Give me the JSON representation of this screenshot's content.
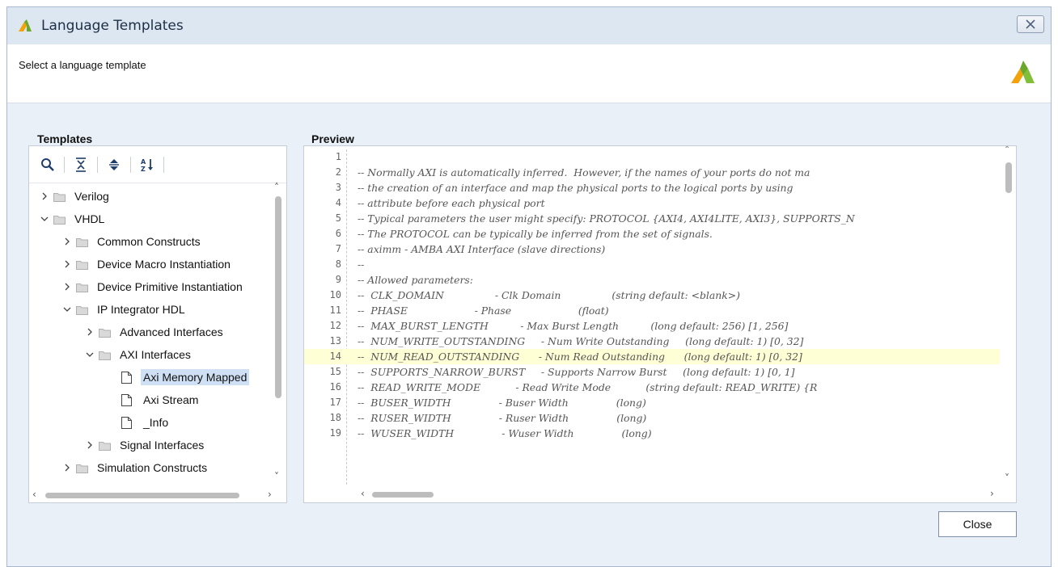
{
  "window": {
    "title": "Language Templates",
    "close_icon": "close-window-icon"
  },
  "header": {
    "instruction": "Select a language template",
    "logo": "xilinx-vivado-logo"
  },
  "templates": {
    "label": "Templates",
    "toolbar": [
      {
        "name": "search-icon",
        "tooltip": ""
      },
      {
        "name": "collapse-all-icon",
        "tooltip": ""
      },
      {
        "name": "expand-all-icon",
        "tooltip": ""
      },
      {
        "name": "sort-alpha-icon",
        "tooltip": ""
      }
    ],
    "tree": [
      {
        "label": "Verilog",
        "depth": 0,
        "kind": "folder",
        "expanded": false
      },
      {
        "label": "VHDL",
        "depth": 0,
        "kind": "folder",
        "expanded": true
      },
      {
        "label": "Common Constructs",
        "depth": 1,
        "kind": "folder",
        "expanded": false
      },
      {
        "label": "Device Macro Instantiation",
        "depth": 1,
        "kind": "folder",
        "expanded": false
      },
      {
        "label": "Device Primitive Instantiation",
        "depth": 1,
        "kind": "folder",
        "expanded": false
      },
      {
        "label": "IP Integrator HDL",
        "depth": 1,
        "kind": "folder",
        "expanded": true
      },
      {
        "label": "Advanced Interfaces",
        "depth": 2,
        "kind": "folder",
        "expanded": false
      },
      {
        "label": "AXI Interfaces",
        "depth": 2,
        "kind": "folder",
        "expanded": true
      },
      {
        "label": "Axi Memory Mapped",
        "depth": 3,
        "kind": "file",
        "selected": true
      },
      {
        "label": "Axi Stream",
        "depth": 3,
        "kind": "file"
      },
      {
        "label": "_Info",
        "depth": 3,
        "kind": "file"
      },
      {
        "label": "Signal Interfaces",
        "depth": 2,
        "kind": "folder",
        "expanded": false
      },
      {
        "label": "Simulation Constructs",
        "depth": 1,
        "kind": "folder",
        "expanded": false
      }
    ]
  },
  "preview": {
    "label": "Preview",
    "highlight_line": 14,
    "lines": [
      {
        "n": "1",
        "text": ""
      },
      {
        "n": "2",
        "text": "-- Normally AXI is automatically inferred.  However, if the names of your ports do not ma"
      },
      {
        "n": "3",
        "text": "-- the creation of an interface and map the physical ports to the logical ports by using"
      },
      {
        "n": "4",
        "text": "-- attribute before each physical port"
      },
      {
        "n": "5",
        "text": "-- Typical parameters the user might specify: PROTOCOL {AXI4, AXI4LITE, AXI3}, SUPPORTS_N"
      },
      {
        "n": "6",
        "text": "-- The PROTOCOL can be typically be inferred from the set of signals."
      },
      {
        "n": "7",
        "text": "-- aximm - AMBA AXI Interface (slave directions)"
      },
      {
        "n": "8",
        "text": "--"
      },
      {
        "n": "9",
        "text": "-- Allowed parameters:"
      },
      {
        "n": "10",
        "text": "--  CLK_DOMAIN                - Clk Domain                (string default: <blank>)"
      },
      {
        "n": "11",
        "text": "--  PHASE                     - Phase                     (float)"
      },
      {
        "n": "12",
        "text": "--  MAX_BURST_LENGTH          - Max Burst Length          (long default: 256) [1, 256]"
      },
      {
        "n": "13",
        "text": "--  NUM_WRITE_OUTSTANDING     - Num Write Outstanding     (long default: 1) [0, 32]"
      },
      {
        "n": "14",
        "text": "--  NUM_READ_OUTSTANDING      - Num Read Outstanding      (long default: 1) [0, 32]"
      },
      {
        "n": "15",
        "text": "--  SUPPORTS_NARROW_BURST     - Supports Narrow Burst     (long default: 1) [0, 1]"
      },
      {
        "n": "16",
        "text": "--  READ_WRITE_MODE           - Read Write Mode           (string default: READ_WRITE) {R"
      },
      {
        "n": "17",
        "text": "--  BUSER_WIDTH               - Buser Width               (long)"
      },
      {
        "n": "18",
        "text": "--  RUSER_WIDTH               - Ruser Width               (long)"
      },
      {
        "n": "19",
        "text": "--  WUSER_WIDTH               - Wuser Width               (long)"
      }
    ]
  },
  "footer": {
    "close_label": "Close"
  }
}
